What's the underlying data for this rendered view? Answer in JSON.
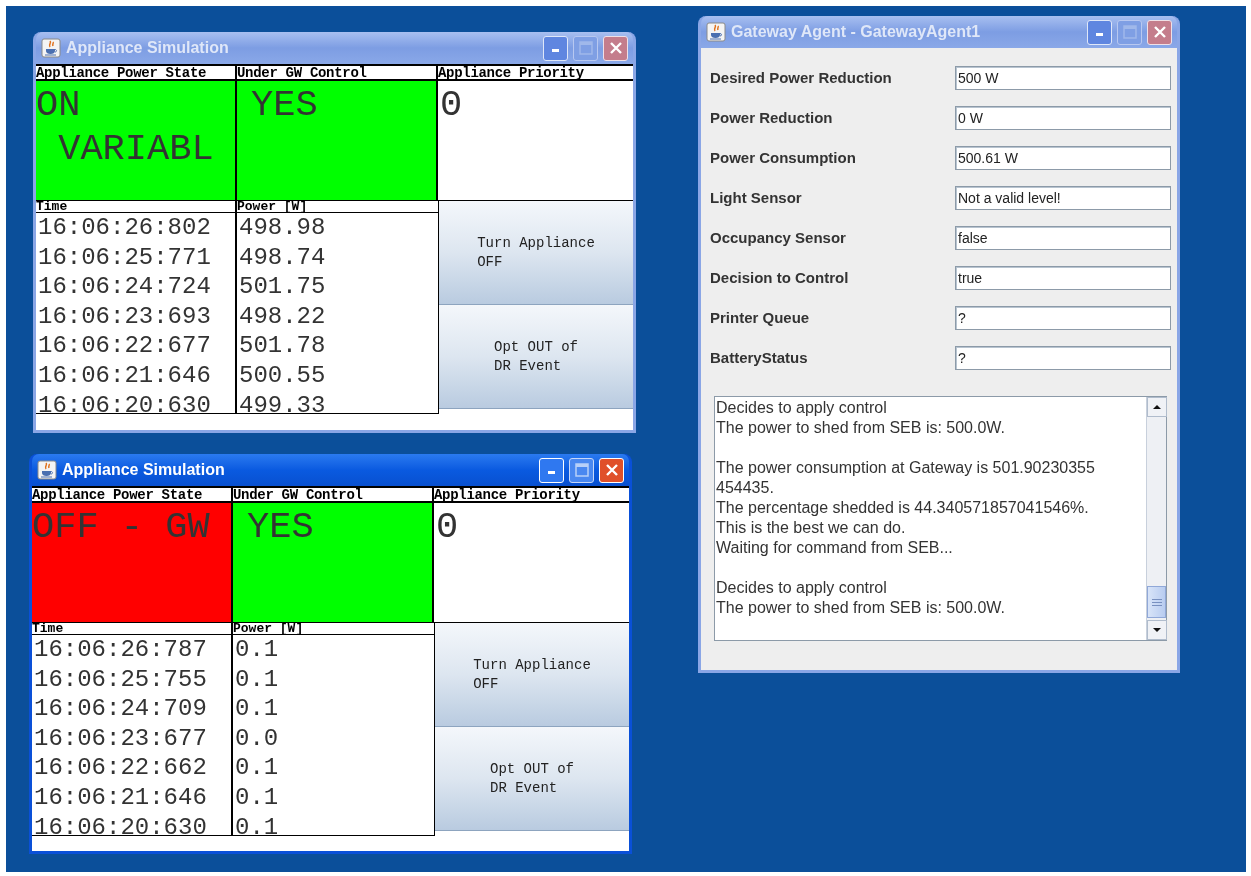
{
  "windows": [
    {
      "kind": "appliance",
      "title": "Appliance Simulation",
      "active": false,
      "columns": [
        "Appliance Power State",
        "Under GW Control",
        "Appliance Priority"
      ],
      "power_state": {
        "text": "ON\n VARIABL",
        "color": "#00ff00"
      },
      "gw_control": {
        "text": "YES",
        "color": "#00ff00"
      },
      "priority": "0",
      "log_columns": [
        "Time",
        "Power [W]"
      ],
      "readings": [
        {
          "time": "16:06:26:802",
          "power": "498.98"
        },
        {
          "time": "16:06:25:771",
          "power": "498.74"
        },
        {
          "time": "16:06:24:724",
          "power": "501.75"
        },
        {
          "time": "16:06:23:693",
          "power": "498.22"
        },
        {
          "time": "16:06:22:677",
          "power": "501.78"
        },
        {
          "time": "16:06:21:646",
          "power": "500.55"
        },
        {
          "time": "16:06:20:630",
          "power": "499.33"
        }
      ],
      "buttons": [
        "Turn Appliance\nOFF",
        "Opt OUT of\nDR Event"
      ]
    },
    {
      "kind": "gateway",
      "title": "Gateway Agent - GatewayAgent1",
      "active": false,
      "fields": [
        {
          "label": "Desired Power Reduction",
          "value": "500 W"
        },
        {
          "label": "Power Reduction",
          "value": "0 W"
        },
        {
          "label": "Power Consumption",
          "value": "500.61 W"
        },
        {
          "label": "Light Sensor",
          "value": "Not a valid level!"
        },
        {
          "label": "Occupancy Sensor",
          "value": "false"
        },
        {
          "label": "Decision to Control",
          "value": "true"
        },
        {
          "label": "Printer Queue",
          "value": "?"
        },
        {
          "label": "BatteryStatus",
          "value": "?"
        }
      ],
      "log": [
        [
          "Decides to apply control",
          "The power to shed from SEB is: 500.0W."
        ],
        [
          "The power consumption at Gateway is 501.90230355",
          "454435.",
          "The percentage shedded is 44.340571857041546%.",
          "This is the best we can do.",
          "Waiting for command from SEB..."
        ],
        [
          "Decides to apply control",
          "The power to shed from SEB is: 500.0W."
        ]
      ]
    },
    {
      "kind": "appliance",
      "title": "Appliance Simulation",
      "active": true,
      "columns": [
        "Appliance Power State",
        "Under GW Control",
        "Appliance Priority"
      ],
      "power_state": {
        "text": "OFF - GW",
        "color": "#ff0000"
      },
      "gw_control": {
        "text": "YES",
        "color": "#00ff00"
      },
      "priority": "0",
      "log_columns": [
        "Time",
        "Power [W]"
      ],
      "readings": [
        {
          "time": "16:06:26:787",
          "power": "0.1"
        },
        {
          "time": "16:06:25:755",
          "power": "0.1"
        },
        {
          "time": "16:06:24:709",
          "power": "0.1"
        },
        {
          "time": "16:06:23:677",
          "power": "0.0"
        },
        {
          "time": "16:06:22:662",
          "power": "0.1"
        },
        {
          "time": "16:06:21:646",
          "power": "0.1"
        },
        {
          "time": "16:06:20:630",
          "power": "0.1"
        }
      ],
      "buttons": [
        "Turn Appliance\nOFF",
        "Opt OUT of\nDR Event"
      ]
    }
  ]
}
